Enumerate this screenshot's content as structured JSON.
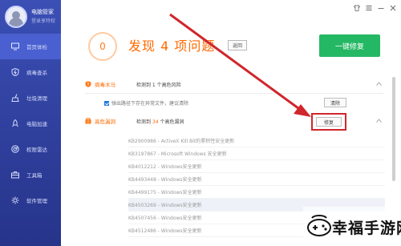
{
  "user": {
    "name": "电脑管家",
    "subtitle": "登录享特权"
  },
  "nav": [
    {
      "label": "首页体检",
      "icon": "monitor-icon",
      "active": true
    },
    {
      "label": "病毒查杀",
      "icon": "shield-lightning-icon"
    },
    {
      "label": "垃圾清理",
      "icon": "broom-icon"
    },
    {
      "label": "电脑加速",
      "icon": "rocket-icon"
    },
    {
      "label": "权限雷达",
      "icon": "radar-icon"
    },
    {
      "label": "工具箱",
      "icon": "toolbox-icon"
    },
    {
      "label": "软件管理",
      "icon": "gear-icon"
    }
  ],
  "topbar": [
    "tshirt-icon",
    "menu-icon",
    "minimize-icon",
    "close-icon"
  ],
  "header": {
    "score": "0",
    "headline": "发现 4 项问题",
    "back_label": "返回",
    "fix_all_label": "一键修复"
  },
  "sections": {
    "virus": {
      "title": "病毒木马",
      "desc": "检测到 1 个高危风险"
    },
    "patch": {
      "title": "高危漏洞",
      "desc_prefix": "检测到 ",
      "desc_count": "34",
      "desc_suffix": " 个高危漏洞"
    }
  },
  "virus_item": {
    "text": "弹出路径下存在异常文件，建议清除",
    "button": "清除"
  },
  "repair_label": "修复",
  "patches": [
    "KB2900986 - ActiveX Kill Bit的累积性安全更新",
    "KB3197867 - Microsoft Windows 安全更新",
    "KB4012212 - Windows安全更新",
    "KB4493448 - Windows安全更新",
    "KB4499175 - Windows安全更新",
    "KB4503269 - Windows安全更新",
    "KB4507456 - Windows安全更新",
    "KB4512486 - Windows安全更新"
  ],
  "watermark": "幸福手游网",
  "colors": {
    "accent": "#ff6a00",
    "sidebar": "#3346a8",
    "green": "#25b864",
    "highlight": "#d0262c"
  }
}
